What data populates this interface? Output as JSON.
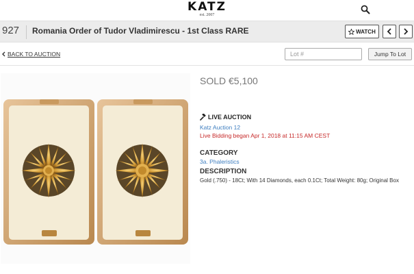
{
  "header": {
    "logo": "KATZ",
    "logo_tagline": "est. 2007",
    "search_icon": "search-icon"
  },
  "lot": {
    "number": "927",
    "title": "Romania Order of Tudor Vladimirescu - 1st Class RARE",
    "watch_label": "WATCH",
    "prev_icon": "chevron-left-icon",
    "next_icon": "chevron-right-icon"
  },
  "nav": {
    "back_label": "BACK TO AUCTION",
    "lot_input_placeholder": "Lot #",
    "jump_label": "Jump To Lot"
  },
  "details": {
    "price": "SOLD €5,100",
    "live_heading": "LIVE AUCTION",
    "auction_name": "Katz Auction 12",
    "bidding_text": "Live Bidding began Apr 1, 2018 at 11:15 AM CEST",
    "category_heading": "CATEGORY",
    "category_value": "3a. Phaleristics",
    "description_heading": "DESCRIPTION",
    "description_text": "Gold (.750) - 18Ct; With 14 Diamonds, each 0.1Ct; Total Weight: 80g; Original Box"
  },
  "colors": {
    "link": "#3d7dbf",
    "alert": "#c62828",
    "bar_bg": "#ececec"
  }
}
